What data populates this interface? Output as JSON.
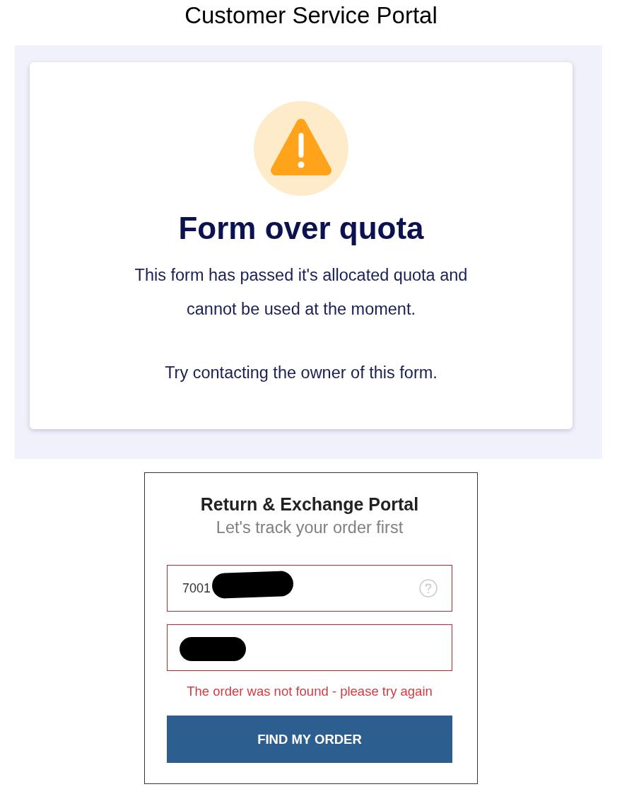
{
  "page_title": "Customer Service Portal",
  "quota_notice": {
    "heading": "Form over quota",
    "paragraphs": [
      "This form has passed it's allocated quota and cannot be used at the moment.",
      "Try contacting the owner of this form."
    ]
  },
  "portal": {
    "title": "Return & Exchange Portal",
    "subtitle": "Let's track your order first",
    "fields": [
      {
        "value": "7001",
        "redacted": true,
        "help": true,
        "error": true
      },
      {
        "redacted": true,
        "help": false,
        "error": true
      }
    ],
    "error_message": "The order was not found - please try again",
    "button": "FIND MY ORDER"
  }
}
